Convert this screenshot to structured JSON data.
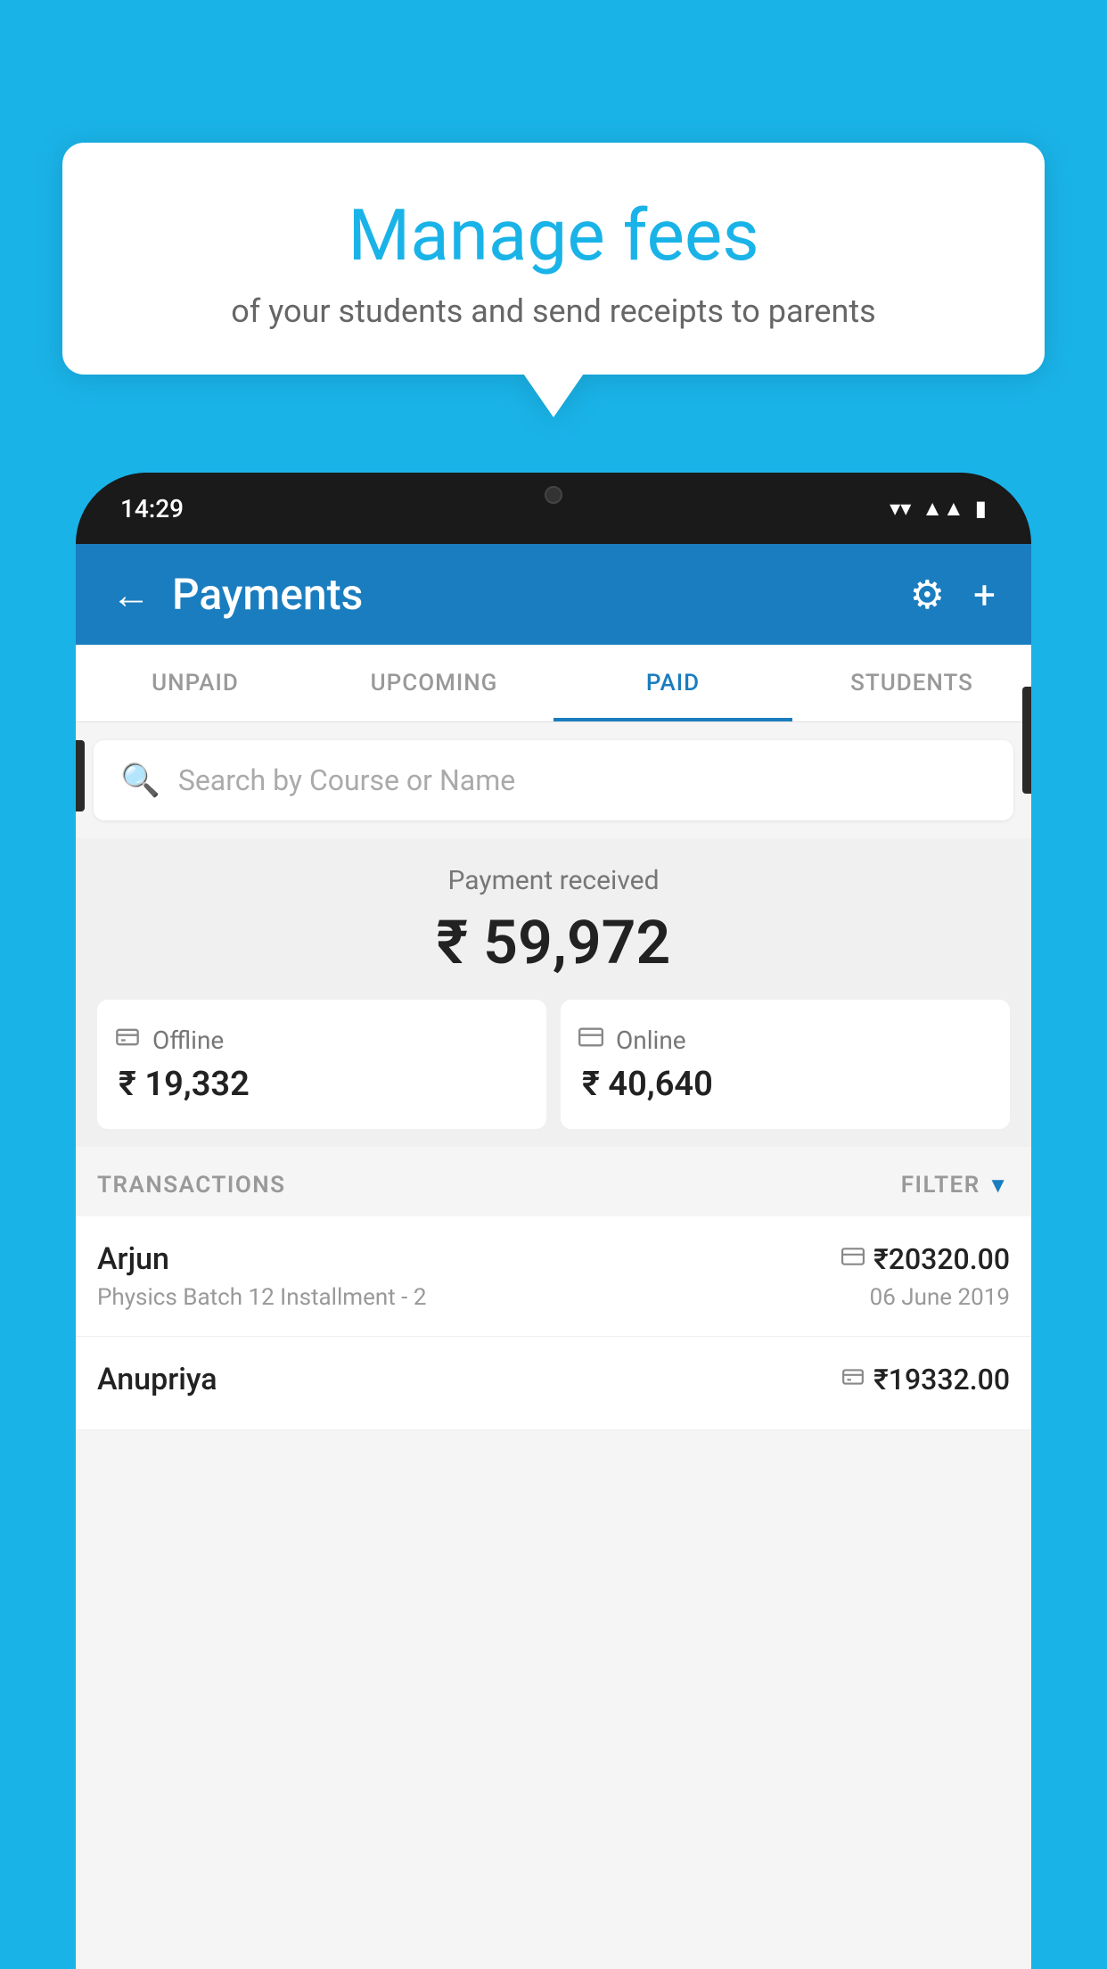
{
  "background_color": "#1ab3e8",
  "speech_bubble": {
    "title": "Manage fees",
    "subtitle": "of your students and send receipts to parents"
  },
  "phone": {
    "time": "14:29",
    "status_icons": [
      "wifi",
      "signal",
      "battery"
    ]
  },
  "app": {
    "header": {
      "title": "Payments",
      "back_label": "←",
      "gear_label": "⚙",
      "plus_label": "+"
    },
    "tabs": [
      {
        "label": "UNPAID",
        "active": false
      },
      {
        "label": "UPCOMING",
        "active": false
      },
      {
        "label": "PAID",
        "active": true
      },
      {
        "label": "STUDENTS",
        "active": false
      }
    ],
    "search": {
      "placeholder": "Search by Course or Name"
    },
    "payment_summary": {
      "label": "Payment received",
      "amount": "₹ 59,972",
      "cards": [
        {
          "type": "Offline",
          "amount": "₹ 19,332",
          "icon": "cash"
        },
        {
          "type": "Online",
          "amount": "₹ 40,640",
          "icon": "card"
        }
      ]
    },
    "transactions": {
      "section_label": "TRANSACTIONS",
      "filter_label": "FILTER",
      "items": [
        {
          "name": "Arjun",
          "detail": "Physics Batch 12 Installment - 2",
          "amount": "₹20320.00",
          "date": "06 June 2019",
          "icon": "card"
        },
        {
          "name": "Anupriya",
          "detail": "",
          "amount": "₹19332.00",
          "date": "",
          "icon": "cash"
        }
      ]
    }
  }
}
